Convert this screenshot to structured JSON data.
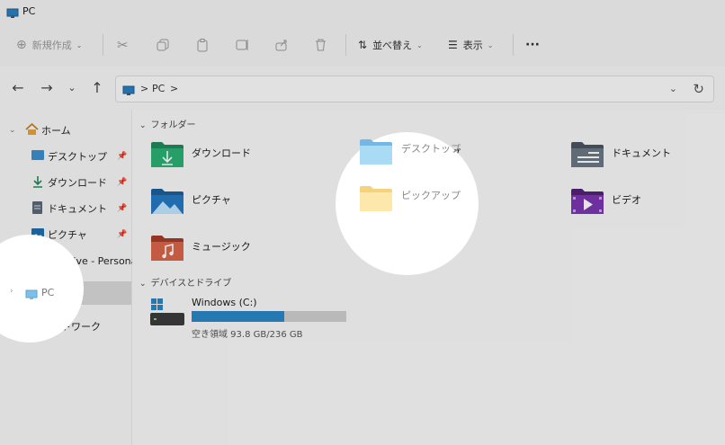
{
  "window": {
    "title": "PC"
  },
  "toolbar": {
    "new_label": "新規作成",
    "sort_label": "並べ替え",
    "view_label": "表示",
    "more_label": "···"
  },
  "address": {
    "crumbs": [
      "PC"
    ],
    "separator": ">"
  },
  "sidebar": {
    "items": [
      {
        "label": "ホーム"
      },
      {
        "label": "デスクトップ"
      },
      {
        "label": "ダウンロード"
      },
      {
        "label": "ドキュメント"
      },
      {
        "label": "ピクチャ"
      },
      {
        "label": "OneDrive - Personal"
      },
      {
        "label": "PC"
      },
      {
        "label": "ネットワーク"
      }
    ]
  },
  "folders_section": {
    "title": "フォルダー"
  },
  "folders": [
    {
      "label": "ダウンロード",
      "icon": "download-folder-icon",
      "color": "#1f8a5b"
    },
    {
      "label": "デスクトップ",
      "icon": "desktop-folder-icon",
      "color": "#4aa3d8"
    },
    {
      "label": "ドキュメント",
      "icon": "documents-folder-icon",
      "color": "#5b6875"
    },
    {
      "label": "ピクチャ",
      "icon": "pictures-folder-icon",
      "color": "#1f6fb0"
    },
    {
      "label": "ピックアップ",
      "icon": "folder-icon",
      "color": "#f4c64c"
    },
    {
      "label": "ビデオ",
      "icon": "videos-folder-icon",
      "color": "#6b2c93"
    },
    {
      "label": "ミュージック",
      "icon": "music-folder-icon",
      "color": "#c5532f"
    }
  ],
  "drives_section": {
    "title": "デバイスとドライブ"
  },
  "drives": [
    {
      "label": "Windows (C:)",
      "free_text": "空き領域 93.8 GB/236 GB",
      "used_fraction": 0.6
    }
  ],
  "colors": {
    "accent": "#2a86c4"
  }
}
